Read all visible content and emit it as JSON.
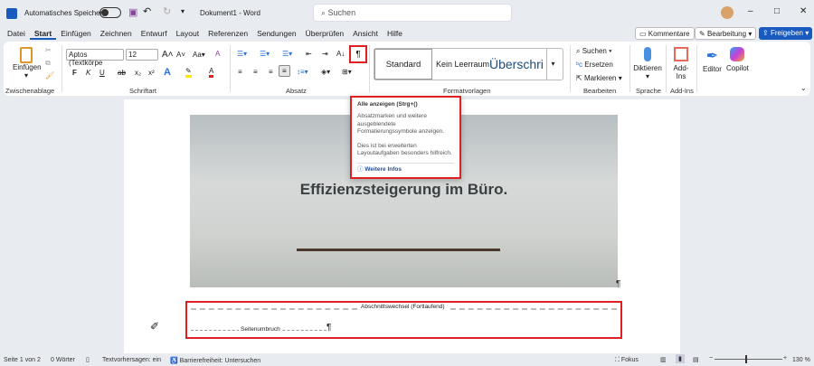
{
  "titlebar": {
    "autosave": "Automatisches Speichern",
    "doc_title": "Dokument1  -  Word",
    "search_placeholder": "Suchen"
  },
  "tabs": [
    "Datei",
    "Start",
    "Einfügen",
    "Zeichnen",
    "Entwurf",
    "Layout",
    "Referenzen",
    "Sendungen",
    "Überprüfen",
    "Ansicht",
    "Hilfe"
  ],
  "actions": {
    "comments": "Kommentare",
    "editing": "Bearbeitung",
    "share": "Freigeben"
  },
  "ribbon": {
    "clipboard": {
      "paste": "Einfügen",
      "label": "Zwischenablage"
    },
    "font": {
      "name": "Aptos (Textkörpe",
      "size": "12",
      "label": "Schriftart",
      "bold": "F",
      "italic": "K",
      "underline": "U"
    },
    "paragraph": {
      "label": "Absatz",
      "pilcrow": "¶"
    },
    "styles": {
      "items": [
        "Standard",
        "Kein Leerraum",
        "Überschri"
      ],
      "label": "Formatvorlagen"
    },
    "editing": {
      "find": "Suchen",
      "replace": "Ersetzen",
      "select": "Markieren",
      "label": "Bearbeiten"
    },
    "voice": {
      "dictate": "Diktieren",
      "label": "Sprache"
    },
    "addins": {
      "button": "Add-Ins",
      "label": "Add-Ins"
    },
    "editor": "Editor",
    "copilot": "Copilot"
  },
  "tooltip": {
    "title": "Alle anzeigen (Strg+()",
    "body1": "Absatzmarken und weitere ausgeblendete Formatierungssymbole anzeigen.",
    "body2": "Dies ist bei erweiterten Layoutaufgaben besonders hilfreich.",
    "link": "Weitere Infos"
  },
  "document": {
    "headline": "Effizienzsteigerung im Büro.",
    "section_break": "Abschnittswechsel (Fortlaufend)",
    "page_break": "Seitenumbruch",
    "pilcrow": "¶"
  },
  "status": {
    "page": "Seite 1 von 2",
    "words": "0 Wörter",
    "predictions": "Textvorhersagen: ein",
    "accessibility": "Barrierefreiheit: Untersuchen",
    "focus": "Fokus",
    "zoom": "130 %"
  },
  "colors": {
    "accent": "#185abd",
    "highlight": "#e02020"
  }
}
